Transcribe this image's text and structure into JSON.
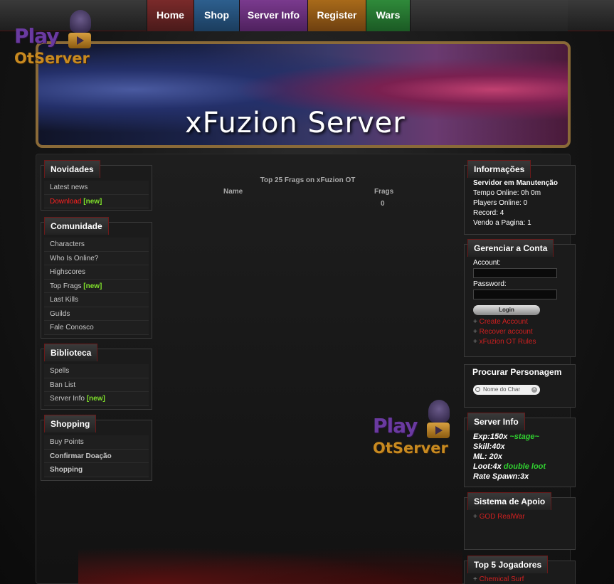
{
  "nav": {
    "home": "Home",
    "shop": "Shop",
    "server_info": "Server Info",
    "register": "Register",
    "wars": "Wars"
  },
  "logo": {
    "play": "Play",
    "otserver": "OtServer"
  },
  "banner": {
    "title": "xFuzion Server"
  },
  "left": {
    "novidades": {
      "title": "Novidades",
      "items": [
        "Latest news",
        "Download",
        "[new]"
      ]
    },
    "comunidade": {
      "title": "Comunidade",
      "items": [
        "Characters",
        "Who Is Online?",
        "Highscores",
        "Top Frags",
        "[new]",
        "Last Kills",
        "Guilds",
        "Fale Conosco"
      ]
    },
    "biblioteca": {
      "title": "Biblioteca",
      "items": [
        "Spells",
        "Ban List",
        "Server Info",
        "[new]"
      ]
    },
    "shopping": {
      "title": "Shopping",
      "items": [
        "Buy Points",
        "Confirmar Doação",
        "Shopping"
      ]
    }
  },
  "center": {
    "title": "Top 25 Frags on xFuzion OT",
    "col_name": "Name",
    "col_frags": "Frags",
    "frags_value": "0"
  },
  "right": {
    "info": {
      "title": "Informações",
      "status": "Servidor em Manutenção",
      "uptime": "Tempo Online: 0h 0m",
      "players": "Players Online: 0",
      "record": "Record: 4",
      "viewing": "Vendo a Pagina: 1"
    },
    "account": {
      "title": "Gerenciar a Conta",
      "account_label": "Account:",
      "password_label": "Password:",
      "login": "Login",
      "links": [
        "Create Account",
        "Recover account",
        "xFuzion OT Rules"
      ]
    },
    "search": {
      "title": "Procurar Personagem",
      "placeholder": "Nome do Char"
    },
    "server_info": {
      "title": "Server Info",
      "exp": "Exp:150x",
      "exp_extra": "~stage~",
      "skill": "Skill:40x",
      "ml": "ML: 20x",
      "loot": "Loot:4x",
      "loot_extra": "double loot",
      "spawn": "Rate Spawn:3x"
    },
    "support": {
      "title": "Sistema de Apoio",
      "item": "GOD RealWar"
    },
    "top5": {
      "title": "Top 5 Jogadores",
      "item": "Chemical Surf"
    }
  }
}
